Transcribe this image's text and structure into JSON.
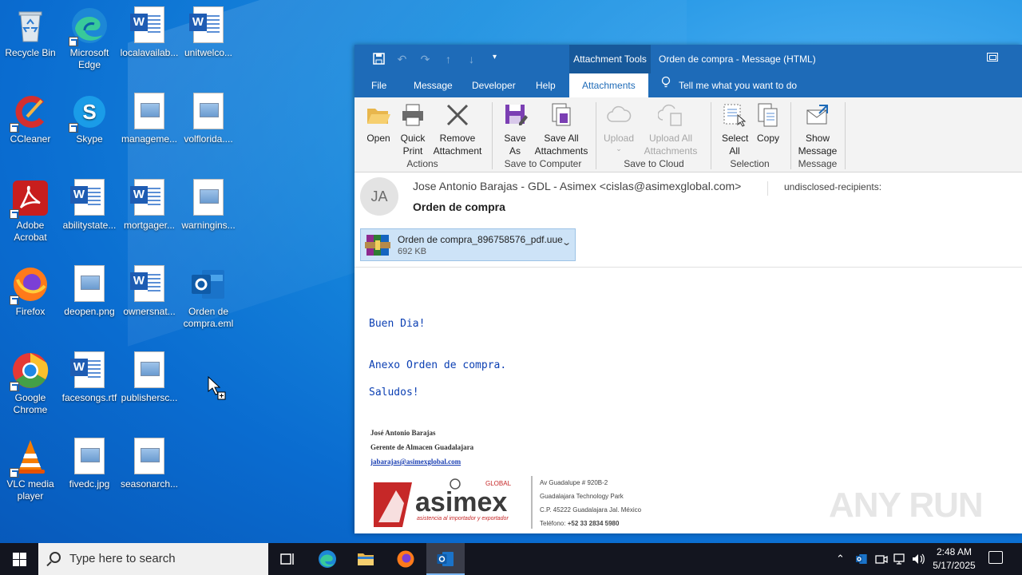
{
  "desktop": {
    "icons": [
      {
        "label": "Recycle Bin"
      },
      {
        "label": "Microsoft Edge"
      },
      {
        "label": "localavailab..."
      },
      {
        "label": "unitwelco..."
      },
      {
        "label": "CCleaner"
      },
      {
        "label": "Skype"
      },
      {
        "label": "manageme..."
      },
      {
        "label": "volflorida...."
      },
      {
        "label": "Adobe Acrobat"
      },
      {
        "label": "abilitystate..."
      },
      {
        "label": "mortgager..."
      },
      {
        "label": "warningins..."
      },
      {
        "label": "Firefox"
      },
      {
        "label": "deopen.png"
      },
      {
        "label": "ownersnat..."
      },
      {
        "label": "Orden de compra.eml"
      },
      {
        "label": "Google Chrome"
      },
      {
        "label": "facesongs.rtf"
      },
      {
        "label": "publishersc..."
      },
      {
        "label": "VLC media player"
      },
      {
        "label": "fivedc.jpg"
      },
      {
        "label": "seasonarch..."
      }
    ]
  },
  "window": {
    "context_tab": "Attachment Tools",
    "title": "Orden de compra  -  Message (HTML)",
    "tabs": [
      "File",
      "Message",
      "Developer",
      "Help",
      "Attachments"
    ],
    "tell_me": "Tell me what you want to do",
    "ribbon": {
      "open": "Open",
      "quick_print": "Quick Print",
      "remove_attachment": "Remove Attachment",
      "group_actions": "Actions",
      "save_as": "Save As",
      "save_all": "Save All Attachments",
      "group_save_computer": "Save to Computer",
      "upload": "Upload",
      "upload_all": "Upload All Attachments",
      "group_save_cloud": "Save to Cloud",
      "select_all": "Select All",
      "copy": "Copy",
      "group_selection": "Selection",
      "show_message": "Show Message",
      "group_message": "Message"
    }
  },
  "message": {
    "avatar_initials": "JA",
    "from": "Jose Antonio Barajas - GDL - Asimex <cislas@asimexglobal.com>",
    "to": "undisclosed-recipients:",
    "subject": "Orden de compra",
    "attachment": {
      "name": "Orden de compra_896758576_pdf.uue",
      "size": "692 KB"
    },
    "body": [
      "Buen Dia!",
      "Anexo Orden de compra.",
      "Saludos!"
    ],
    "signature": {
      "name": "José Antonio Barajas",
      "role": "Gerente de Almacen Guadalajara",
      "email": "jabarajas@asimexglobal.com",
      "logo_word": "asimex",
      "logo_global": "GLOBAL",
      "logo_tagline": "asistencia al importador y exportador",
      "address_lines": [
        "Av Guadalupe # 920B-2",
        "Guadalajara Technology Park",
        "C.P. 45222 Guadalajara Jal. México"
      ],
      "phone_label": "Teléfono:",
      "phone": "+52 33 2834 5980"
    },
    "watermark": "ANY RUN"
  },
  "taskbar": {
    "search_placeholder": "Type here to search",
    "time": "2:48 AM",
    "date": "5/17/2025"
  }
}
